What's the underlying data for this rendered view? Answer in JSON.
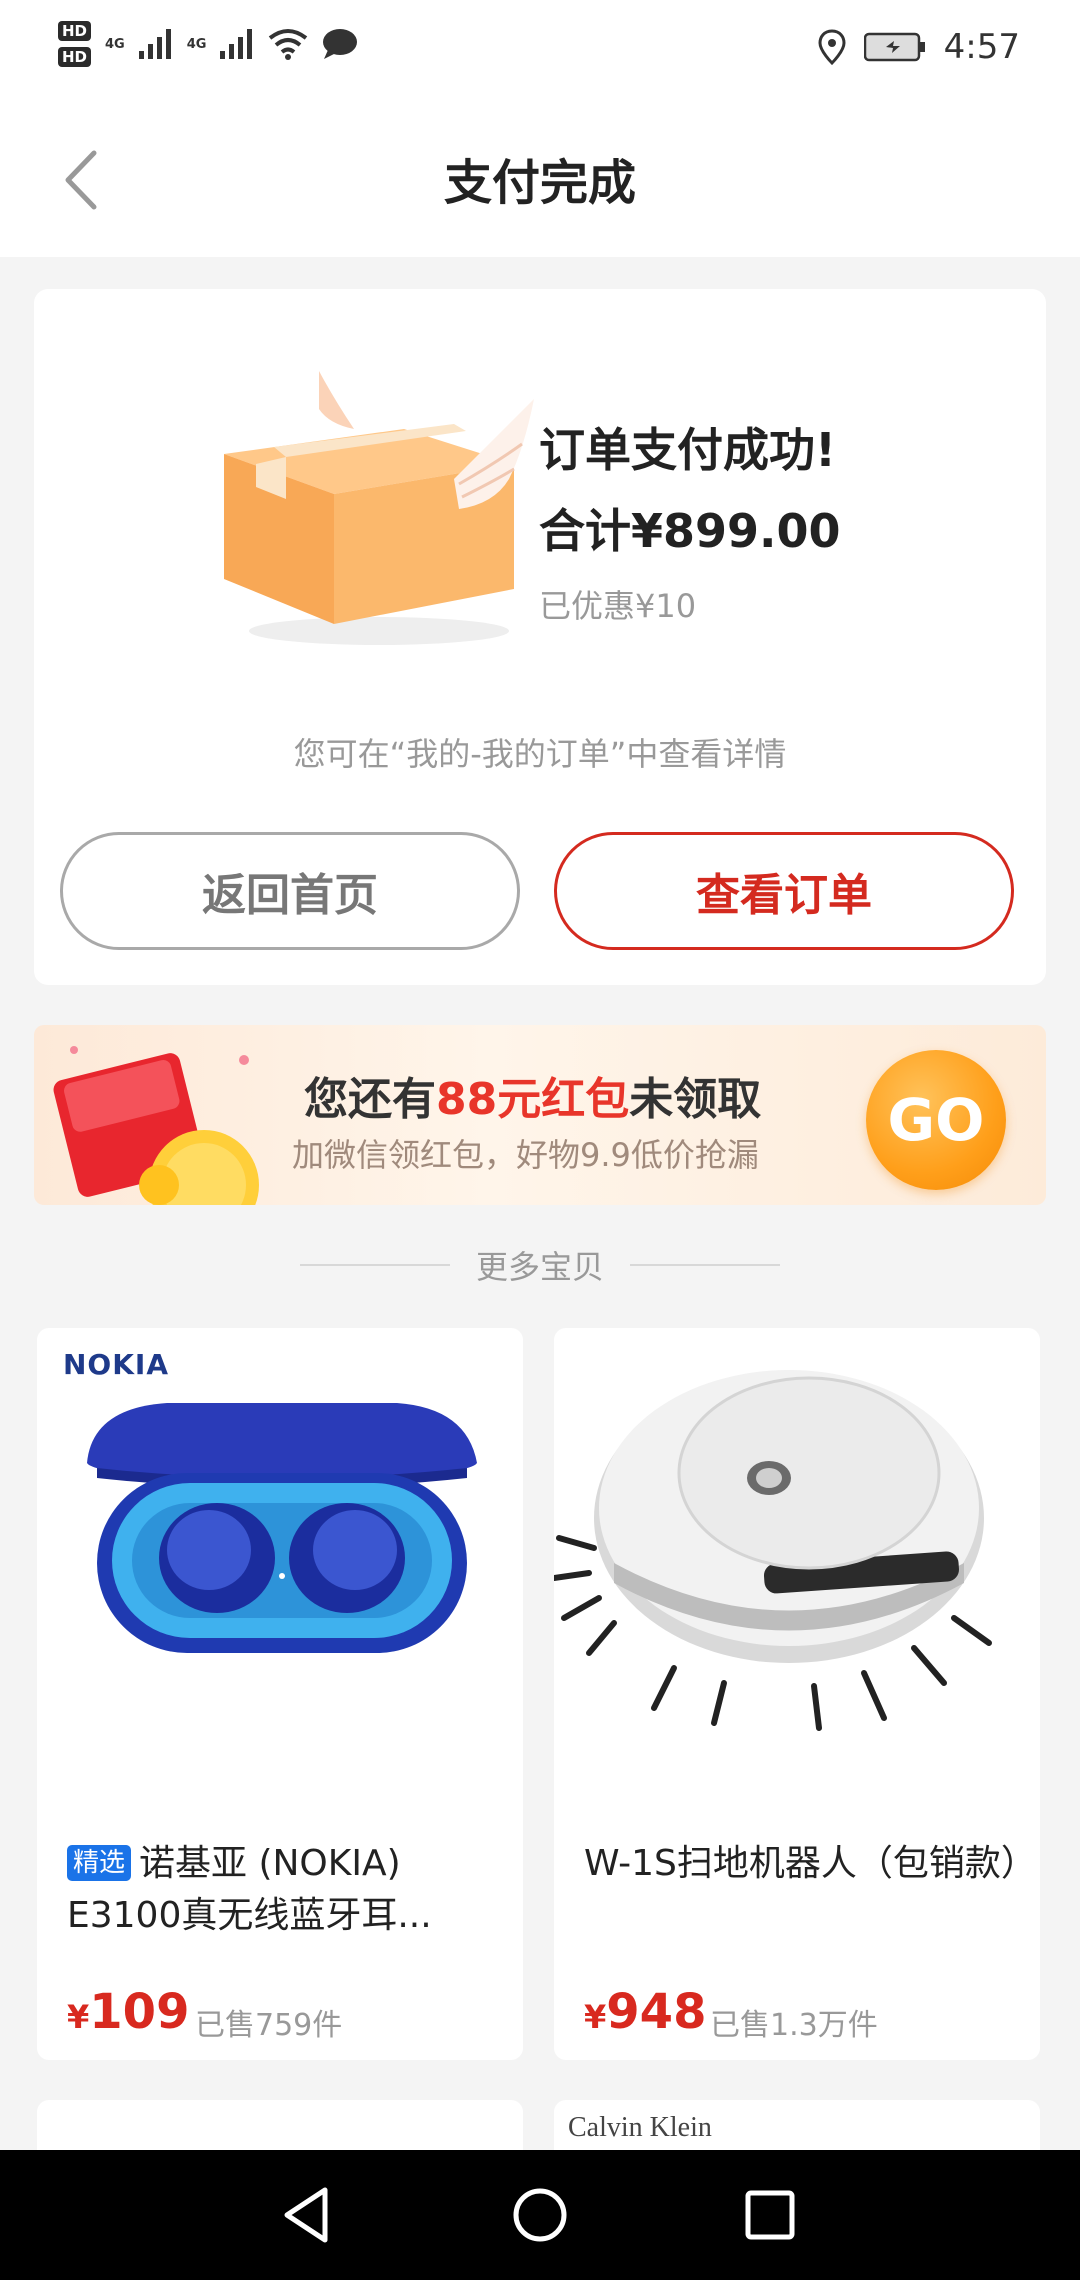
{
  "status_bar": {
    "hd1": "HD",
    "hd2": "HD",
    "net1": "4G",
    "net2": "4G",
    "time": "4:57"
  },
  "header": {
    "title": "支付完成"
  },
  "success": {
    "title": "订单支付成功!",
    "total": "合计¥899.00",
    "discount": "已优惠¥10",
    "hint": "您可在“我的-我的订单”中查看详情",
    "btn_home": "返回首页",
    "btn_order": "查看订单"
  },
  "banner": {
    "main_prefix": "您还有",
    "main_highlight": "88元红包",
    "main_suffix": "未领取",
    "sub": "加微信领红包，好物9.9低价抢漏",
    "go": "GO"
  },
  "more": {
    "label": "更多宝贝"
  },
  "products": [
    {
      "brand": "NOKIA",
      "tag": "精选",
      "title": "诺基亚 (NOKIA) E3100真无线蓝牙耳...",
      "currency": "¥",
      "price": "109",
      "sold": "已售759件"
    },
    {
      "title": "W-1S扫地机器人（包销款）",
      "currency": "¥",
      "price": "948",
      "sold": "已售1.3万件"
    }
  ],
  "next_row": {
    "brand_right": "Calvin Klein"
  },
  "icons": {
    "back": "back-chevron-icon",
    "location": "location-icon",
    "battery": "battery-icon",
    "wifi": "wifi-icon",
    "message": "message-icon",
    "nav_back": "nav-back-icon",
    "nav_home": "nav-home-icon",
    "nav_recent": "nav-recent-icon"
  },
  "colors": {
    "accent_red": "#d42a1f",
    "price_red": "#d8291f",
    "tag_blue": "#1a73e8",
    "go_orange": "#ff9f1a"
  }
}
